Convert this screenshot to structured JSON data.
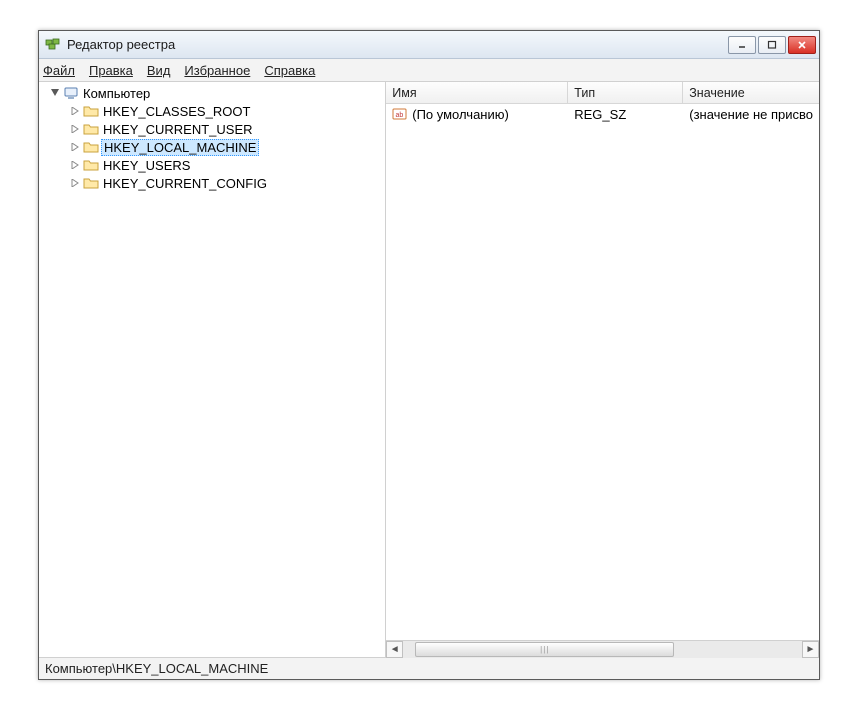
{
  "window": {
    "title": "Редактор реестра"
  },
  "menu": {
    "file": "Файл",
    "edit": "Правка",
    "view": "Вид",
    "favorites": "Избранное",
    "help": "Справка"
  },
  "tree": {
    "root": {
      "label": "Компьютер",
      "expanded": true
    },
    "children": [
      {
        "label": "HKEY_CLASSES_ROOT",
        "selected": false
      },
      {
        "label": "HKEY_CURRENT_USER",
        "selected": false
      },
      {
        "label": "HKEY_LOCAL_MACHINE",
        "selected": true
      },
      {
        "label": "HKEY_USERS",
        "selected": false
      },
      {
        "label": "HKEY_CURRENT_CONFIG",
        "selected": false
      }
    ]
  },
  "list": {
    "columns": {
      "name": "Имя",
      "type": "Тип",
      "value": "Значение"
    },
    "rows": [
      {
        "name": "(По умолчанию)",
        "type": "REG_SZ",
        "value": "(значение не присво"
      }
    ]
  },
  "statusbar": {
    "path": "Компьютер\\HKEY_LOCAL_MACHINE"
  }
}
